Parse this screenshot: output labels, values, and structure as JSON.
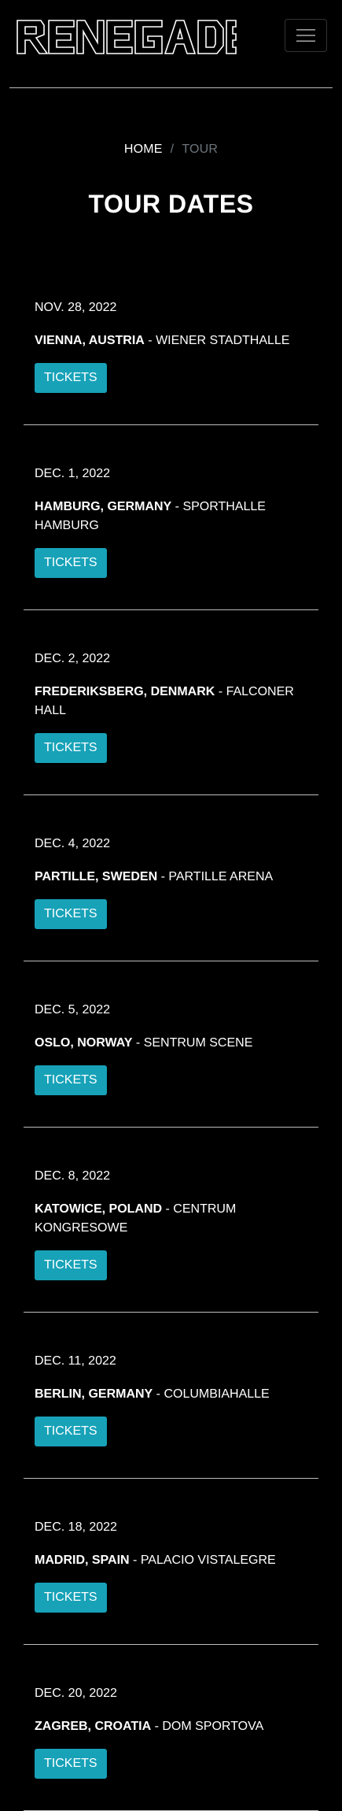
{
  "header": {
    "logo_text": "RENEGADE",
    "menu_icon": "hamburger-icon"
  },
  "breadcrumb": {
    "home": "HOME",
    "separator": "/",
    "current": "TOUR"
  },
  "page_title": "TOUR DATES",
  "tickets_label": "TICKETS",
  "tour_dates": [
    {
      "date": "NOV. 28, 2022",
      "city": "VIENNA, AUSTRIA",
      "venue": " - WIENER STADTHALLE"
    },
    {
      "date": "DEC. 1, 2022",
      "city": "HAMBURG, GERMANY",
      "venue": " - SPORTHALLE HAMBURG"
    },
    {
      "date": "DEC. 2, 2022",
      "city": "FREDERIKSBERG, DENMARK",
      "venue": " - FALCONER HALL"
    },
    {
      "date": "DEC. 4, 2022",
      "city": "PARTILLE, SWEDEN",
      "venue": " - PARTILLE ARENA"
    },
    {
      "date": "DEC. 5, 2022",
      "city": "OSLO, NORWAY",
      "venue": " - SENTRUM SCENE"
    },
    {
      "date": "DEC. 8, 2022",
      "city": "KATOWICE, POLAND",
      "venue": " - CENTRUM KONGRESOWE"
    },
    {
      "date": "DEC. 11, 2022",
      "city": "BERLIN, GERMANY",
      "venue": " - COLUMBIAHALLE"
    },
    {
      "date": "DEC. 18, 2022",
      "city": "MADRID, SPAIN",
      "venue": " - PALACIO VISTALEGRE"
    },
    {
      "date": "DEC. 20, 2022",
      "city": "ZAGREB, CROATIA",
      "venue": " - DOM SPORTOVA"
    }
  ]
}
